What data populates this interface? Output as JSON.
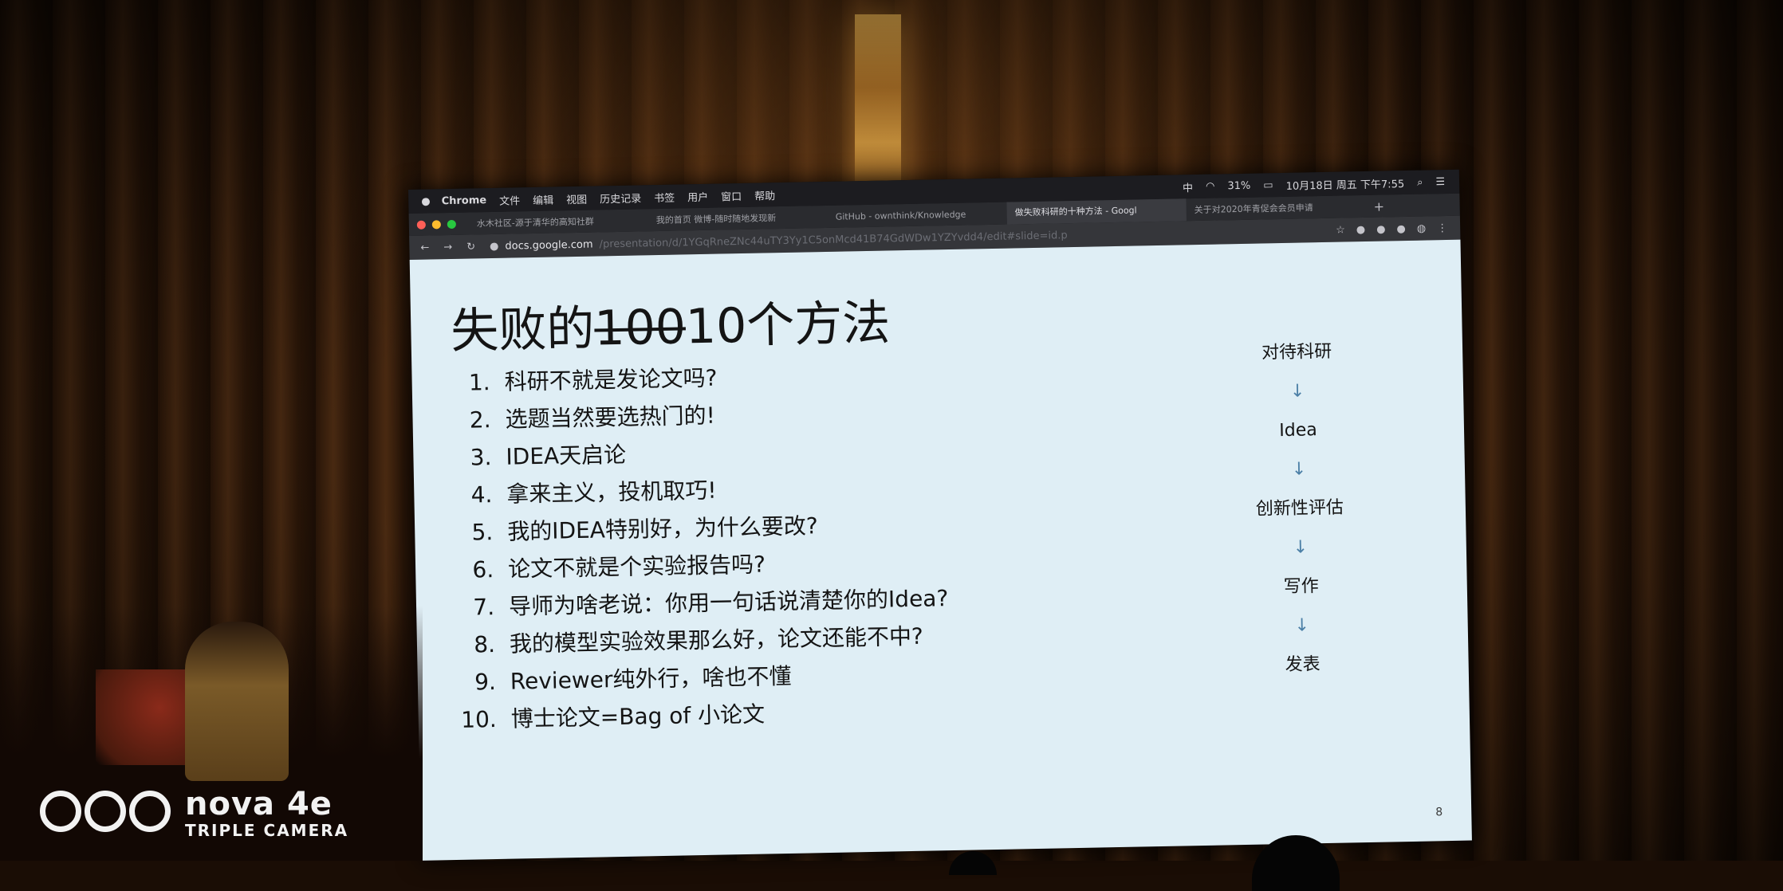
{
  "photo": {
    "watermark": {
      "brand": "nova 4e",
      "subtitle": "TRIPLE CAMERA"
    }
  },
  "menubar": {
    "app_name": "Chrome",
    "items": [
      "文件",
      "编辑",
      "视图",
      "历史记录",
      "书签",
      "用户",
      "窗口",
      "帮助"
    ],
    "status": {
      "input_method": "中",
      "battery": "31%",
      "datetime": "10月18日 周五 下午7:55"
    }
  },
  "tabs": [
    {
      "label": "水木社区-源于清华的高知社群",
      "active": false
    },
    {
      "label": "我的首页 微博-随时随地发现新",
      "active": false
    },
    {
      "label": "GitHub - ownthink/Knowledge",
      "active": false
    },
    {
      "label": "做失败科研的十种方法 - Googl",
      "active": true
    },
    {
      "label": "关于对2020年青促会会员申请",
      "active": false
    }
  ],
  "address": {
    "host": "docs.google.com",
    "path": "/presentation/d/1YGqRneZNc44uTY3Yy1C5onMcd41B74GdWDw1YZYvdd4/edit#slide=id.p"
  },
  "slide": {
    "title_before": "失败的",
    "title_struck": "100",
    "title_after": "10个方法",
    "items": [
      {
        "num": "1.",
        "text": "科研不就是发论文吗?"
      },
      {
        "num": "2.",
        "text": "选题当然要选热门的!"
      },
      {
        "num": "3.",
        "text": "IDEA天启论"
      },
      {
        "num": "4.",
        "text": "拿来主义，投机取巧!"
      },
      {
        "num": "5.",
        "text": "我的IDEA特别好，为什么要改?"
      },
      {
        "num": "6.",
        "text": "论文不就是个实验报告吗?"
      },
      {
        "num": "7.",
        "text": "导师为啥老说：你用一句话说清楚你的Idea?"
      },
      {
        "num": "8.",
        "text": "我的模型实验效果那么好，论文还能不中?"
      },
      {
        "num": "9.",
        "text": "Reviewer纯外行，啥也不懂"
      },
      {
        "num": "10.",
        "text": "博士论文=Bag of 小论文"
      }
    ],
    "flow": [
      "对待科研",
      "Idea",
      "创新性评估",
      "写作",
      "发表"
    ],
    "page_number": "8"
  },
  "colors": {
    "slide_bg": "#dfeef5",
    "flow_arrow": "#4b7fa6",
    "chrome_dark": "#35363a"
  }
}
